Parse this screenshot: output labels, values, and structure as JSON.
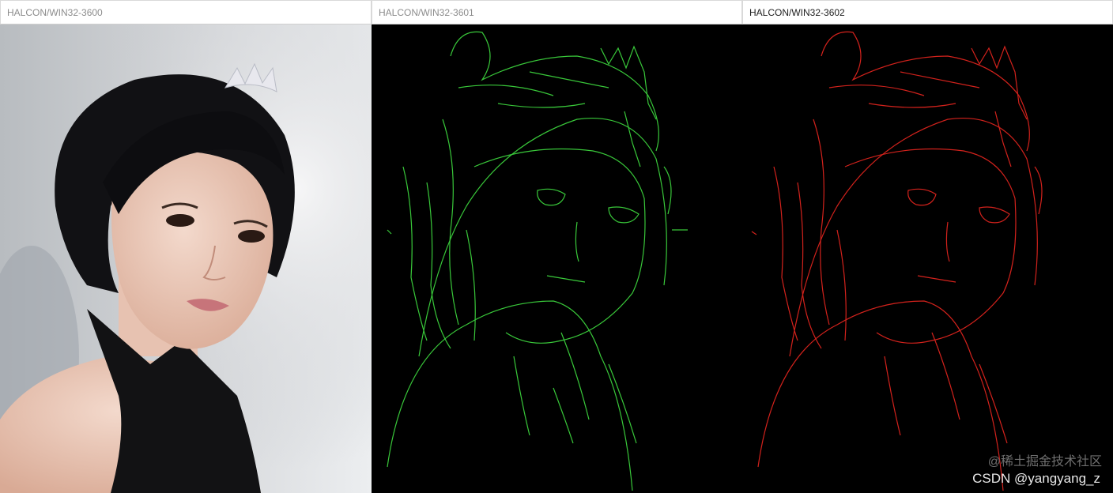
{
  "windows": [
    {
      "title": "HALCON/WIN32-3600",
      "content": "original-photo",
      "active": false
    },
    {
      "title": "HALCON/WIN32-3601",
      "content": "edge-image",
      "edge_color": "#39c83a",
      "active": false
    },
    {
      "title": "HALCON/WIN32-3602",
      "content": "edge-image",
      "edge_color": "#d3221c",
      "active": true
    }
  ],
  "watermark": "@稀土掘金技术社区",
  "credit": "CSDN @yangyang_z"
}
